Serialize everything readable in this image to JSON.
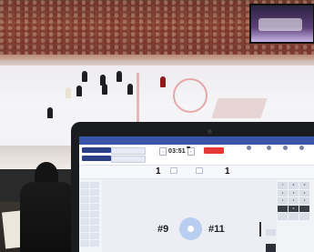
{
  "photo": {
    "scene": "arena",
    "jumbotron_colors": [
      "#2a2440",
      "#c9b6e8"
    ]
  },
  "app": {
    "topbar_items": [
      "",
      "",
      "",
      "",
      ""
    ],
    "selector_primary": "",
    "selector_secondary": "",
    "clock_minus": "‹",
    "clock_time": "03:51",
    "clock_plus": "›",
    "period_label": "",
    "period_sub": "",
    "red_button": "",
    "right_controls": [
      "",
      "",
      "",
      ""
    ],
    "home_label": "",
    "home_score": "1",
    "away_score": "1",
    "away_label": "",
    "tab_left": "",
    "tab_right": "",
    "panel_title": "",
    "ghost_left": "",
    "ghost_right": "",
    "jersey_left": "#9",
    "jersey_right": "#11",
    "left_grid": [
      "",
      "",
      "",
      "",
      "",
      "",
      "",
      "",
      "",
      "",
      "",
      "",
      "",
      "",
      "",
      "",
      "",
      "",
      "",
      ""
    ],
    "left_grid_label": "",
    "right_grid": [
      "7",
      "8",
      "9",
      "4",
      "5",
      "6",
      "1",
      "2",
      "3",
      "",
      "0",
      "",
      "",
      "",
      "",
      "",
      "",
      "",
      "",
      ""
    ],
    "accent_colors": {
      "topbar": "#3a55a8",
      "selector": "#2c3f88",
      "action_red": "#e53935",
      "puck_ring": "#b9cdf0"
    }
  }
}
